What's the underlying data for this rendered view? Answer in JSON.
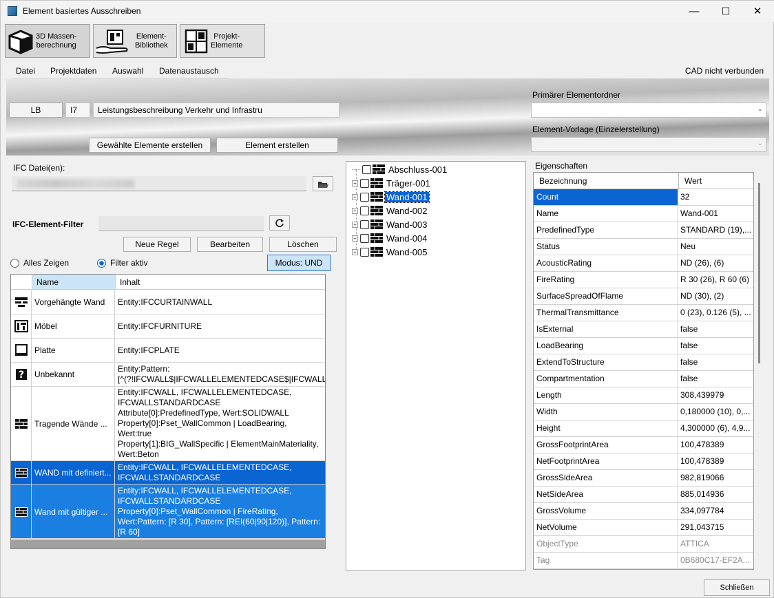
{
  "window": {
    "title": "Element basiertes Ausschreiben",
    "minimize": "—",
    "maximize": "☐",
    "close": "✕"
  },
  "toolbar": {
    "btn1": "3D Massen-\nberechnung",
    "btn2": "Element-\nBibliothek",
    "btn3": "Projekt-\nElemente"
  },
  "menu": {
    "items": [
      "Datei",
      "Projektdaten",
      "Auswahl",
      "Datenaustausch"
    ],
    "cad_status": "CAD nicht verbunden"
  },
  "ribbon": {
    "lb_label": "LB",
    "lb_code": "I7",
    "lb_name": "Leistungsbeschreibung Verkehr und Infrastru",
    "primary_folder_label": "Primärer Elementordner",
    "primary_folder_value": "",
    "template_label": "Element-Vorlage (Einzelerstellung)",
    "template_value": "",
    "btn_create_selected": "Gewählte Elemente erstellen",
    "btn_create_element": "Element erstellen"
  },
  "ifc": {
    "label": "IFC Datei(en):",
    "path": ""
  },
  "filter": {
    "label": "IFC-Element-Filter",
    "input": "",
    "btn_new": "Neue Regel",
    "btn_edit": "Bearbeiten",
    "btn_delete": "Löschen",
    "radio_all": "Alles Zeigen",
    "radio_active": "Filter aktiv",
    "mode": "Modus: UND",
    "col_name": "Name",
    "col_content": "Inhalt",
    "rows": [
      {
        "icon": "curtain-wall-icon",
        "name": "Vorgehängte Wand",
        "content": "Entity:IFCCURTAINWALL"
      },
      {
        "icon": "furniture-icon",
        "name": "Möbel",
        "content": "Entity:IFCFURNITURE"
      },
      {
        "icon": "plate-icon",
        "name": "Platte",
        "content": "Entity:IFCPLATE"
      },
      {
        "icon": "unknown-icon",
        "name": "Unbekannt",
        "content": "Entity:Pattern:\n[^(?!IFCWALL$|IFCWALLELEMENTEDCASE$|IFCWALLS"
      },
      {
        "icon": "wall-icon",
        "name": "Tragende Wände ...",
        "content": "Entity:IFCWALL, IFCWALLELEMENTEDCASE,\nIFCWALLSTANDARDCASE\nAttribute[0]:PredefinedType, Wert:SOLIDWALL\nProperty[0]:Pset_WallCommon | LoadBearing,\nWert:true\nProperty[1]:BIG_WallSpecific | ElementMainMateriality,\nWert:Beton"
      },
      {
        "icon": "wall-icon",
        "name": "WAND mit definiert...",
        "content": "Entity:IFCWALL, IFCWALLELEMENTEDCASE,\nIFCWALLSTANDARDCASE"
      },
      {
        "icon": "wall-icon",
        "name": "Wand mit gültiger ...",
        "content": "Entity:IFCWALL, IFCWALLELEMENTEDCASE,\nIFCWALLSTANDARDCASE\nProperty[0]:Pset_WallCommon | FireRating,\nWert:Pattern: [R 30], Pattern: [REI(60|90|120)], Pattern:\n[R 60]"
      }
    ]
  },
  "tree": {
    "nodes": [
      "Abschluss-001",
      "Träger-001",
      "Wand-001",
      "Wand-002",
      "Wand-003",
      "Wand-004",
      "Wand-005"
    ],
    "selected": "Wand-001"
  },
  "properties": {
    "label": "Eigenschaften",
    "col_key": "Bezeichnung",
    "col_value": "Wert",
    "rows": [
      {
        "k": "Count",
        "v": "32"
      },
      {
        "k": "Name",
        "v": "Wand-001"
      },
      {
        "k": "PredefinedType",
        "v": "STANDARD (19),..."
      },
      {
        "k": "Status",
        "v": "Neu"
      },
      {
        "k": "AcousticRating",
        "v": "ND (26),  (6)"
      },
      {
        "k": "FireRating",
        "v": "R 30 (26), R 60 (6)"
      },
      {
        "k": "SurfaceSpreadOfFlame",
        "v": "ND (30),  (2)"
      },
      {
        "k": "ThermalTransmittance",
        "v": "0 (23), 0.126 (5), ..."
      },
      {
        "k": "IsExternal",
        "v": "false"
      },
      {
        "k": "LoadBearing",
        "v": "false"
      },
      {
        "k": "ExtendToStructure",
        "v": "false"
      },
      {
        "k": "Compartmentation",
        "v": "false"
      },
      {
        "k": "Length",
        "v": "308,439979"
      },
      {
        "k": "Width",
        "v": "0,180000 (10), 0,..."
      },
      {
        "k": "Height",
        "v": "4,300000 (6), 4,9..."
      },
      {
        "k": "GrossFootprintArea",
        "v": "100,478389"
      },
      {
        "k": "NetFootprintArea",
        "v": "100,478389"
      },
      {
        "k": "GrossSideArea",
        "v": "982,819066"
      },
      {
        "k": "NetSideArea",
        "v": "885,014936"
      },
      {
        "k": "GrossVolume",
        "v": "334,097784"
      },
      {
        "k": "NetVolume",
        "v": "291,043715"
      },
      {
        "k": "ObjectType",
        "v": "ATTICA"
      },
      {
        "k": "Tag",
        "v": "0B680C17-EF2A..."
      }
    ]
  },
  "footer": {
    "close": "Schließen"
  }
}
